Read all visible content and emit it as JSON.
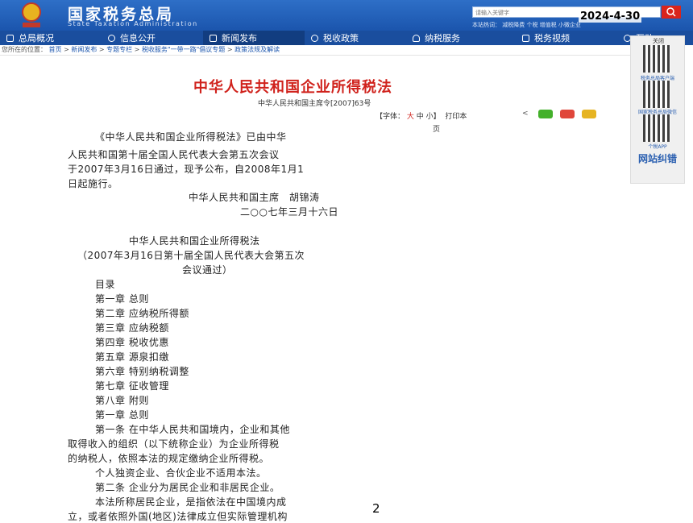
{
  "header": {
    "title": "国家税务总局",
    "subtitle": "State Taxation Administration",
    "search_placeholder": "请输入关键字",
    "hot_words": "本站热词：  减税降费  个税  增值税  小微企业",
    "date_overlay": "2024-4-30"
  },
  "nav": {
    "items": [
      {
        "label": "总局概况",
        "icon": "menu-icon"
      },
      {
        "label": "信息公开",
        "icon": "chat-icon"
      },
      {
        "label": "新闻发布",
        "icon": "news-icon"
      },
      {
        "label": "税收政策",
        "icon": "info-icon"
      },
      {
        "label": "纳税服务",
        "icon": "user-icon"
      },
      {
        "label": "税务视频",
        "icon": "video-icon"
      },
      {
        "label": "互动",
        "icon": "exchange-icon"
      }
    ]
  },
  "breadcrumb": {
    "prefix": "您所在的位置：",
    "items": [
      "首页",
      "新闻发布",
      "专题专栏",
      "税收服务\"一带一路\"倡议专题",
      "政策法规及解读"
    ],
    "separator": " > "
  },
  "side_panel": {
    "close": "关闭",
    "qr_labels": [
      "税务总局客户端",
      "国家税务总局微信",
      "个税APP"
    ],
    "feedback": "网站纠错"
  },
  "article": {
    "title": "中华人民共和国企业所得税法",
    "decree": "中华人民共和国主席令[2007]63号",
    "font_label": "【字体：",
    "font_large": "大",
    "font_mid_small": "中 小】",
    "print": "打印本",
    "print2": "页",
    "lines": [
      "《中华人民共和国企业所得税法》已由中华",
      "人民共和国第十届全国人民代表大会第五次会议",
      "于2007年3月16日通过，现予公布，自2008年1月1",
      "日起施行。",
      "中华人民共和国主席　胡锦涛",
      "二○○七年三月十六日",
      "中华人民共和国企业所得税法",
      "（2007年3月16日第十届全国人民代表大会第五次",
      "会议通过）",
      "目录",
      "第一章 总则",
      "第二章 应纳税所得额",
      "第三章 应纳税额",
      "第四章 税收优惠",
      "第五章 源泉扣缴",
      "第六章 特别纳税调整",
      "第七章 征收管理",
      "第八章 附则",
      "第一章 总则",
      "第一条 在中华人民共和国境内，企业和其他",
      "取得收入的组织（以下统称企业）为企业所得税",
      "的纳税人，依照本法的规定缴纳企业所得税。",
      "个人独资企业、合伙企业不适用本法。",
      "第二条 企业分为居民企业和非居民企业。",
      "本法所称居民企业，是指依法在中国境内成",
      "立，或者依照外国(地区)法律成立但实际管理机构"
    ]
  },
  "page_number": "2"
}
